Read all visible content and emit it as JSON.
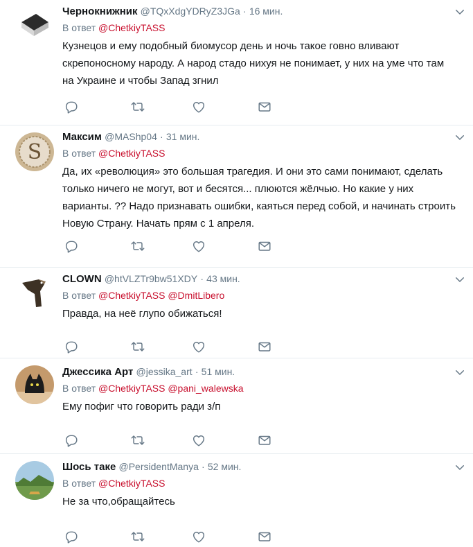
{
  "reply_prefix": "В ответ",
  "tweets": [
    {
      "name": "Чернокнижник",
      "handle": "@TQxXdgYDRyZ3JGa",
      "dot": "·",
      "time": "16 мин.",
      "mentions": [
        "@ChetkiyTASS"
      ],
      "text": "Кузнецов и ему подобный биомусор день и ночь такое говно вливают скрепоносному народу. А народ стадо нихуя не понимает, у них на уме что там на Украине и чтобы Запад згнил"
    },
    {
      "name": "Максим",
      "handle": "@MAShp04",
      "dot": "·",
      "time": "31 мин.",
      "mentions": [
        "@ChetkiyTASS"
      ],
      "text": "Да, их «революция» это большая трагедия. И они это сами понимают, сделать только ничего не могут, вот и бесятся... плюются жёлчью. Но какие у них варианты. ?? Надо признавать ошибки, каяться перед собой, и начинать строить Новую Страну. Начать прям с 1 апреля."
    },
    {
      "name": "CLOWN",
      "handle": "@htVLZTr9bw51XDY",
      "dot": "·",
      "time": "43 мин.",
      "mentions": [
        "@ChetkiyTASS",
        "@DmitLibero"
      ],
      "text": "Правда, на неё глупо обижаться!"
    },
    {
      "name": "Джессика Арт",
      "handle": "@jessika_art",
      "dot": "·",
      "time": "51 мин.",
      "mentions": [
        "@ChetkiyTASS",
        "@pani_walewska"
      ],
      "text": "Ему пофиг что говорить ради з/п"
    },
    {
      "name": "Шось таке",
      "handle": "@PersidentManya",
      "dot": "·",
      "time": "52 мин.",
      "mentions": [
        "@ChetkiyTASS"
      ],
      "text": "Не за что,обращайтесь"
    }
  ]
}
